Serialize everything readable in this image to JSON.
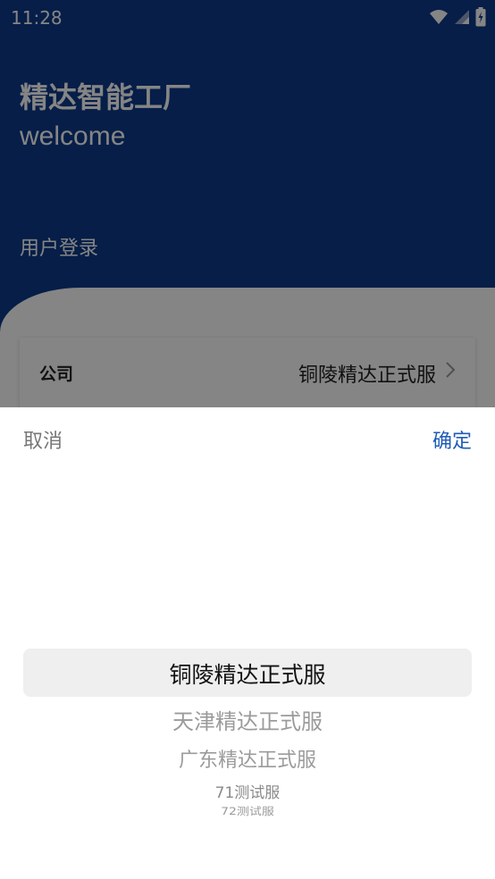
{
  "status_bar": {
    "time": "11:28"
  },
  "header": {
    "title": "精达智能工厂",
    "subtitle": "welcome",
    "login_label": "用户登录"
  },
  "form": {
    "company_label": "公司",
    "company_value": "铜陵精达正式服"
  },
  "picker_sheet": {
    "cancel_label": "取消",
    "confirm_label": "确定",
    "options": [
      "铜陵精达正式服",
      "天津精达正式服",
      "广东精达正式服",
      "71测试服",
      "72测试服"
    ],
    "selected": "铜陵精达正式服"
  },
  "colors": {
    "header_bg": "#0d3b8b",
    "accent": "#1f5bb5",
    "overlay": "rgba(0,0,0,0.48)"
  },
  "icons": [
    "wifi-icon",
    "signal-icon",
    "battery-icon",
    "chevron-right-icon"
  ]
}
